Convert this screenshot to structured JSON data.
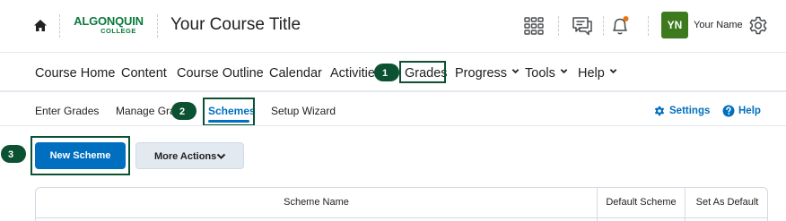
{
  "header": {
    "logo_line1": "ALGONQUIN",
    "logo_line2": "COLLEGE",
    "course_title": "Your Course Title",
    "user_initials": "YN",
    "user_name": "Your Name",
    "brand_color": "#0a7a3c",
    "avatar_color": "#3d7a1e",
    "icons": [
      "home-icon",
      "waffle-grid-icon",
      "message-icon",
      "bell-icon",
      "gear-icon"
    ],
    "notification_dot_color": "#e87511"
  },
  "course_nav": {
    "items": [
      {
        "label": "Course Home"
      },
      {
        "label": "Content"
      },
      {
        "label": "Course Outline"
      },
      {
        "label": "Calendar"
      },
      {
        "label": "Activities"
      },
      {
        "label": "Grades"
      },
      {
        "label": "Progress",
        "has_menu": true
      },
      {
        "label": "Tools",
        "has_menu": true
      },
      {
        "label": "Help",
        "has_menu": true
      }
    ]
  },
  "sub_nav": {
    "items": [
      {
        "label": "Enter Grades"
      },
      {
        "label": "Manage Grades"
      },
      {
        "label": "Schemes",
        "active": true
      },
      {
        "label": "Setup Wizard"
      }
    ],
    "settings_label": "Settings",
    "help_label": "Help",
    "link_color": "#006fbf"
  },
  "actions": {
    "new_scheme_label": "New Scheme",
    "more_actions_label": "More Actions"
  },
  "callouts": [
    {
      "number": "1",
      "target": "Grades"
    },
    {
      "number": "2",
      "target": "Schemes"
    },
    {
      "number": "3",
      "target": "New Scheme"
    }
  ],
  "callout_color": "#0b5132",
  "table": {
    "columns": [
      "Scheme Name",
      "Default Scheme",
      "Set As Default"
    ]
  }
}
